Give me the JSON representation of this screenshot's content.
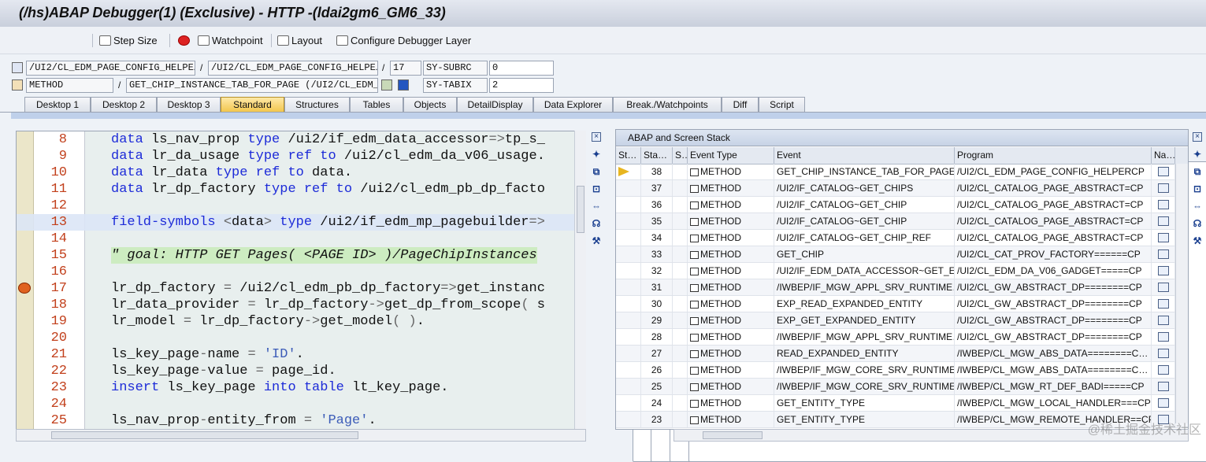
{
  "window": {
    "title": "(/hs)ABAP Debugger(1)  (Exclusive) - HTTP -(ldai2gm6_GM6_33)"
  },
  "toolbar": {
    "step_size": "Step Size",
    "watchpoint": "Watchpoint",
    "layout": "Layout",
    "configure": "Configure Debugger Layer"
  },
  "info": {
    "program": "/UI2/CL_EDM_PAGE_CONFIG_HELPE…",
    "include": "/UI2/CL_EDM_PAGE_CONFIG_HELPE…",
    "line": "17",
    "method_type": "METHOD",
    "method_name": "GET_CHIP_INSTANCE_TAB_FOR_PAGE (/UI2/CL_EDM_…",
    "sy_subrc_label": "SY-SUBRC",
    "sy_subrc_value": "0",
    "sy_tabix_label": "SY-TABIX",
    "sy_tabix_value": "2"
  },
  "tabs": [
    "Desktop 1",
    "Desktop 2",
    "Desktop 3",
    "Standard",
    "Structures",
    "Tables",
    "Objects",
    "DetailDisplay",
    "Data Explorer",
    "Break./Watchpoints",
    "Diff",
    "Script"
  ],
  "active_tab": "Standard",
  "code": [
    {
      "n": "8",
      "t": "data ls_nav_prop type /ui2/if_edm_data_accessor=>tp_s_"
    },
    {
      "n": "9",
      "t": "data lr_da_usage type ref to /ui2/cl_edm_da_v06_usage."
    },
    {
      "n": "10",
      "t": "data lr_data type ref to data."
    },
    {
      "n": "11",
      "t": "data lr_dp_factory type ref to /ui2/cl_edm_pb_dp_facto"
    },
    {
      "n": "12",
      "t": ""
    },
    {
      "n": "13",
      "t": "field-symbols <data> type /ui2/if_edm_mp_pagebuilder=>"
    },
    {
      "n": "14",
      "t": ""
    },
    {
      "n": "15",
      "t": "\" goal: HTTP GET Pages( <PAGE ID> )/PageChipInstances"
    },
    {
      "n": "16",
      "t": ""
    },
    {
      "n": "17",
      "t": "lr_dp_factory = /ui2/cl_edm_pb_dp_factory=>get_instanc"
    },
    {
      "n": "18",
      "t": "lr_data_provider = lr_dp_factory->get_dp_from_scope( s"
    },
    {
      "n": "19",
      "t": "lr_model = lr_dp_factory->get_model( )."
    },
    {
      "n": "20",
      "t": ""
    },
    {
      "n": "21",
      "t": "ls_key_page-name = 'ID'."
    },
    {
      "n": "22",
      "t": "ls_key_page-value = page_id."
    },
    {
      "n": "23",
      "t": "insert ls_key_page into table lt_key_page."
    },
    {
      "n": "24",
      "t": ""
    },
    {
      "n": "25",
      "t": "ls_nav_prop-entity_from = 'Page'."
    }
  ],
  "stack": {
    "title": "ABAP and Screen Stack",
    "columns": [
      "St…",
      "Sta…",
      "S…",
      "Event Type",
      "Event",
      "Program",
      "Na…"
    ],
    "rows": [
      {
        "lvl": "38",
        "type": "METHOD",
        "event": "GET_CHIP_INSTANCE_TAB_FOR_PAGE",
        "program": "/UI2/CL_EDM_PAGE_CONFIG_HELPERCP",
        "current": true
      },
      {
        "lvl": "37",
        "type": "METHOD",
        "event": "/UI2/IF_CATALOG~GET_CHIPS",
        "program": "/UI2/CL_CATALOG_PAGE_ABSTRACT=CP"
      },
      {
        "lvl": "36",
        "type": "METHOD",
        "event": "/UI2/IF_CATALOG~GET_CHIP",
        "program": "/UI2/CL_CATALOG_PAGE_ABSTRACT=CP"
      },
      {
        "lvl": "35",
        "type": "METHOD",
        "event": "/UI2/IF_CATALOG~GET_CHIP",
        "program": "/UI2/CL_CATALOG_PAGE_ABSTRACT=CP"
      },
      {
        "lvl": "34",
        "type": "METHOD",
        "event": "/UI2/IF_CATALOG~GET_CHIP_REF",
        "program": "/UI2/CL_CATALOG_PAGE_ABSTRACT=CP"
      },
      {
        "lvl": "33",
        "type": "METHOD",
        "event": "GET_CHIP",
        "program": "/UI2/CL_CAT_PROV_FACTORY======CP"
      },
      {
        "lvl": "32",
        "type": "METHOD",
        "event": "/UI2/IF_EDM_DATA_ACCESSOR~GET_E…",
        "program": "/UI2/CL_EDM_DA_V06_GADGET=====CP"
      },
      {
        "lvl": "31",
        "type": "METHOD",
        "event": "/IWBEP/IF_MGW_APPL_SRV_RUNTIME…",
        "program": "/UI2/CL_GW_ABSTRACT_DP========CP"
      },
      {
        "lvl": "30",
        "type": "METHOD",
        "event": "EXP_READ_EXPANDED_ENTITY",
        "program": "/UI2/CL_GW_ABSTRACT_DP========CP"
      },
      {
        "lvl": "29",
        "type": "METHOD",
        "event": "EXP_GET_EXPANDED_ENTITY",
        "program": "/UI2/CL_GW_ABSTRACT_DP========CP"
      },
      {
        "lvl": "28",
        "type": "METHOD",
        "event": "/IWBEP/IF_MGW_APPL_SRV_RUNTIME…",
        "program": "/UI2/CL_GW_ABSTRACT_DP========CP"
      },
      {
        "lvl": "27",
        "type": "METHOD",
        "event": "READ_EXPANDED_ENTITY",
        "program": "/IWBEP/CL_MGW_ABS_DATA========C…"
      },
      {
        "lvl": "26",
        "type": "METHOD",
        "event": "/IWBEP/IF_MGW_CORE_SRV_RUNTIME…",
        "program": "/IWBEP/CL_MGW_ABS_DATA========C…"
      },
      {
        "lvl": "25",
        "type": "METHOD",
        "event": "/IWBEP/IF_MGW_CORE_SRV_RUNTIME…",
        "program": "/IWBEP/CL_MGW_RT_DEF_BADI=====CP"
      },
      {
        "lvl": "24",
        "type": "METHOD",
        "event": "GET_ENTITY_TYPE",
        "program": "/IWBEP/CL_MGW_LOCAL_HANDLER===CP"
      },
      {
        "lvl": "23",
        "type": "METHOD",
        "event": "GET_ENTITY_TYPE",
        "program": "/IWBEP/CL_MGW_REMOTE_HANDLER==CP"
      }
    ]
  },
  "watermark": "@稀土掘金技术社区"
}
